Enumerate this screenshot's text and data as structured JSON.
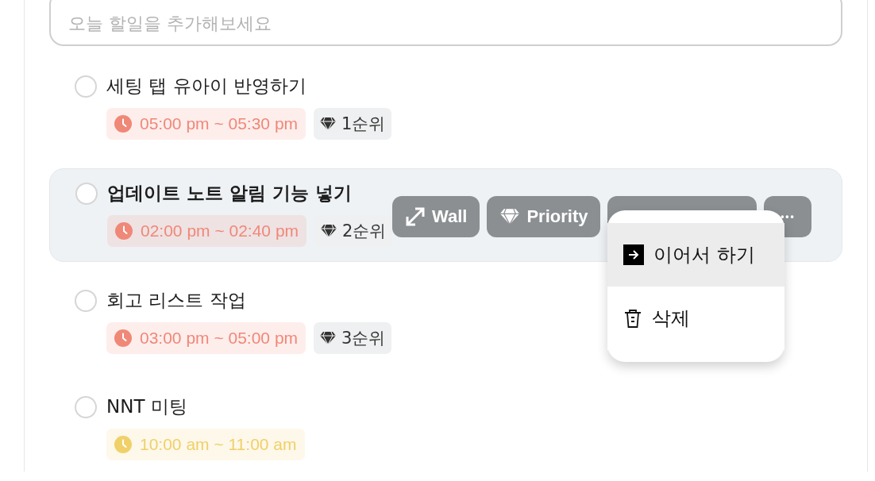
{
  "new_task": {
    "placeholder": "오늘 할일을 추가해보세요"
  },
  "tasks": [
    {
      "title": "세팅 탭 유아이 반영하기",
      "checked": false,
      "hovered": false,
      "time": "05:00 pm ~ 05:30 pm",
      "color": "#f08878",
      "priority": "1순위"
    },
    {
      "title": "업데이트 노트 알림 기능 넣기",
      "checked": false,
      "hovered": true,
      "time": "02:00 pm ~ 02:40 pm",
      "color": "#f08878",
      "priority": "2순위"
    },
    {
      "title": "회고 리스트 작업",
      "checked": false,
      "hovered": false,
      "time": "03:00 pm ~ 05:00 pm",
      "color": "#f08878",
      "priority": "3순위"
    },
    {
      "title": "NNT 미팅",
      "checked": false,
      "hovered": false,
      "time": "10:00 am ~ 11:00 am",
      "color": "#f0d068"
    }
  ],
  "hover_actions": [
    {
      "kind": "wall",
      "label": "Wall"
    },
    {
      "kind": "priority",
      "label": "Priority"
    },
    {
      "kind": "hidden"
    },
    {
      "kind": "more",
      "label": "•••"
    }
  ],
  "menu": {
    "items": [
      {
        "kind": "continue",
        "label": "이어서 하기",
        "selected": true
      },
      {
        "kind": "delete",
        "label": "삭제",
        "selected": false
      }
    ]
  }
}
